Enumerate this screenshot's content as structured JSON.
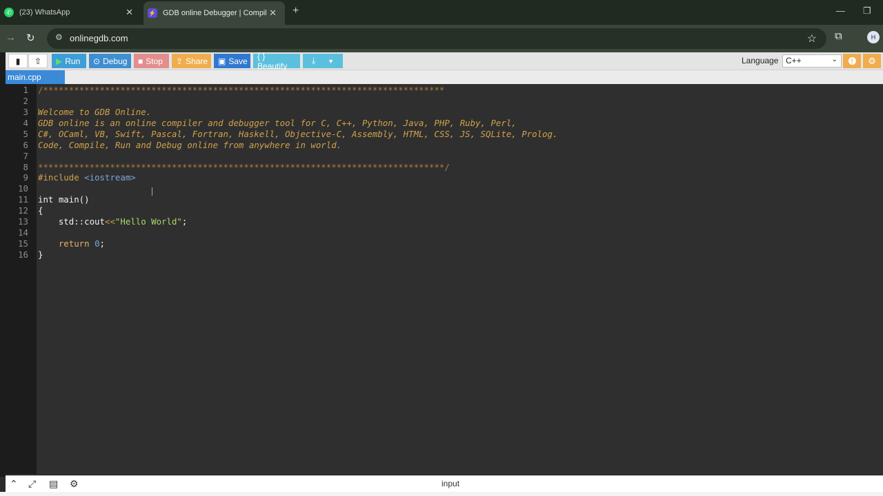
{
  "browser": {
    "tabs": [
      {
        "title": "(23) WhatsApp",
        "icon": "whatsapp-icon",
        "active": false
      },
      {
        "title": "GDB online Debugger | Compile",
        "icon": "gdb-icon",
        "active": true
      }
    ],
    "url": "onlinegdb.com",
    "profile_initial": "H"
  },
  "toolbar": {
    "run": "Run",
    "debug": "Debug",
    "stop": "Stop",
    "share": "Share",
    "save": "Save",
    "beautify": "{ } Beautify",
    "language_label": "Language",
    "language_value": "C++"
  },
  "file_tab": "main.cpp",
  "editor": {
    "line_numbers": [
      "1",
      "2",
      "3",
      "4",
      "5",
      "6",
      "7",
      "8",
      "9",
      "10",
      "11",
      "12",
      "13",
      "14",
      "15",
      "16"
    ],
    "comment_top": "/******************************************************************************",
    "comment_bottom": "*******************************************************************************/",
    "comment_lines": [
      "Welcome to GDB Online.",
      "GDB online is an online compiler and debugger tool for C, C++, Python, Java, PHP, Ruby, Perl,",
      "C#, OCaml, VB, Swift, Pascal, Fortran, Haskell, Objective-C, Assembly, HTML, CSS, JS, SQLite, Prolog.",
      "Code, Compile, Run and Debug online from anywhere in world."
    ],
    "include_directive": "#include",
    "include_header": "<iostream>",
    "main_signature": "int main()",
    "open_brace": "{",
    "cout_target": "std::cout",
    "cout_op": "<<",
    "cout_string": "\"Hello World\"",
    "cout_end": ";",
    "return_kw": "return",
    "return_value": "0",
    "return_end": ";",
    "close_brace": "}"
  },
  "bottom": {
    "input_label": "input"
  },
  "colors": {
    "accent_blue": "#3a8ad8",
    "editor_bg": "#2f2f2f",
    "comment": "#d1a24a"
  }
}
